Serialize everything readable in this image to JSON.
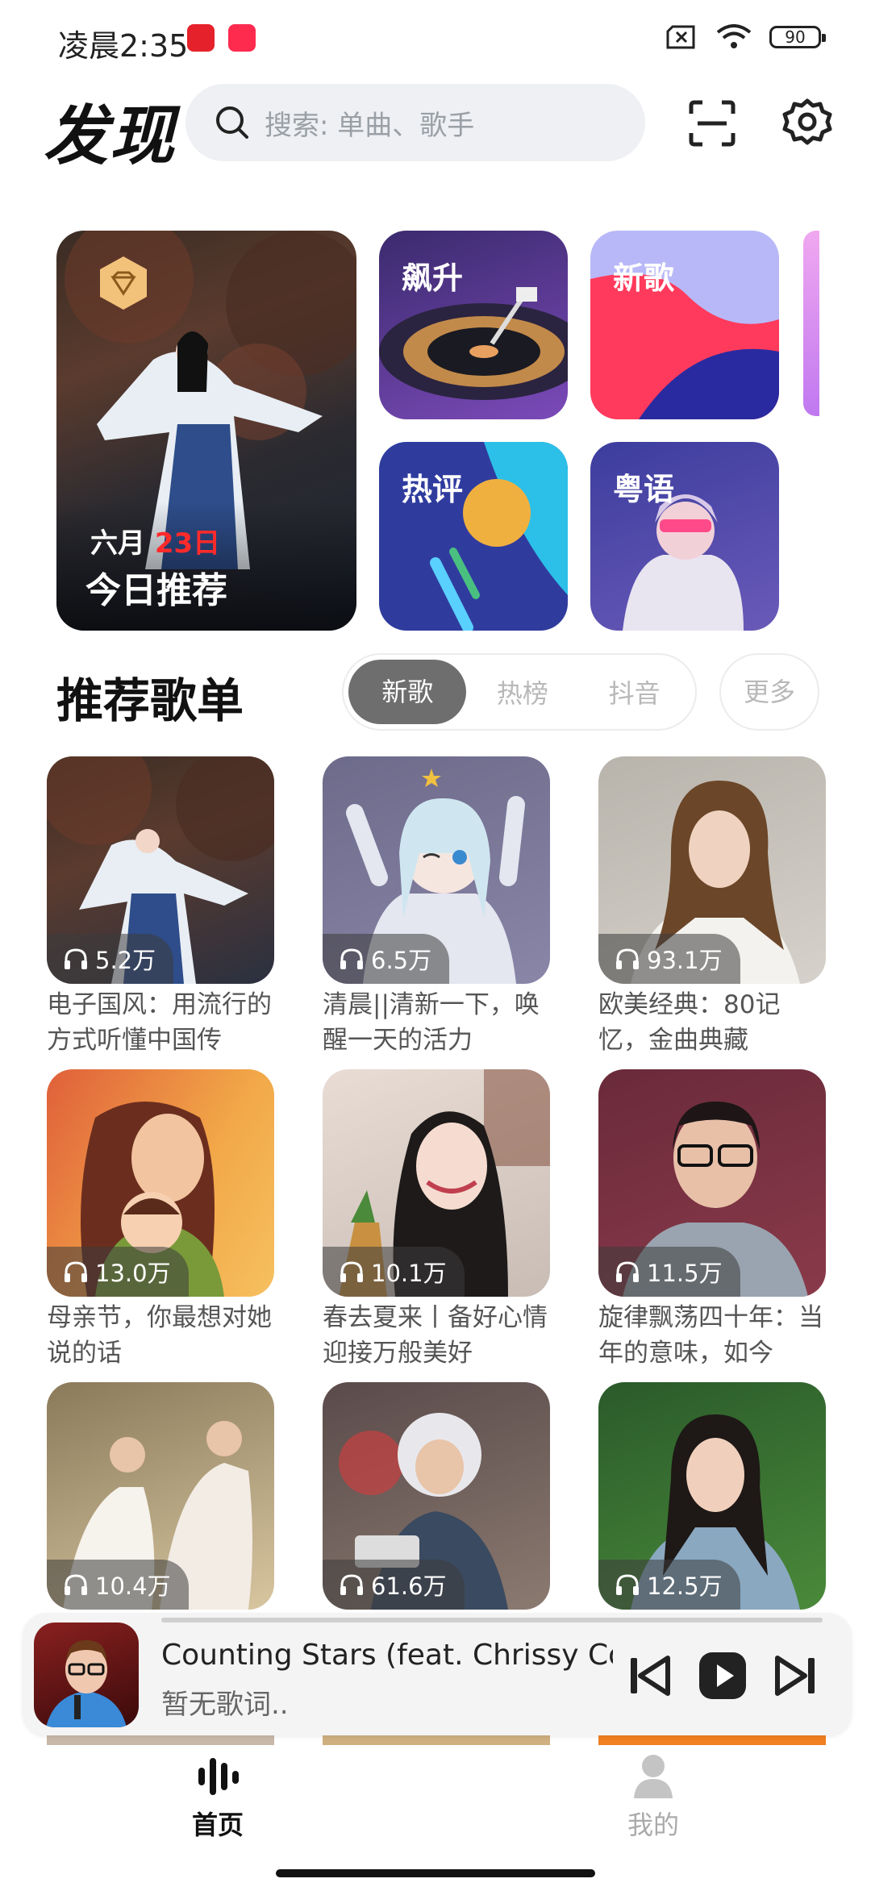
{
  "status_bar": {
    "time": "凌晨2:35",
    "battery": "90"
  },
  "header": {
    "title": "发现",
    "search_placeholder": "搜索: 单曲、歌手"
  },
  "featured": {
    "date_month": "六月",
    "date_day": "23日",
    "label": "今日推荐",
    "tiles": [
      "飙升",
      "新歌",
      "热评",
      "粤语"
    ]
  },
  "section": {
    "title": "推荐歌单",
    "tabs": [
      "新歌",
      "热榜",
      "抖音"
    ],
    "active_tab": "新歌",
    "more_label": "更多"
  },
  "playlists": [
    {
      "plays": "5.2万",
      "title": "电子国风：用流行的方式听懂中国传"
    },
    {
      "plays": "6.5万",
      "title": "清晨||清新一下，唤醒一天的活力"
    },
    {
      "plays": "93.1万",
      "title": "欧美经典：80记忆，金曲典藏"
    },
    {
      "plays": "13.0万",
      "title": "母亲节，你最想对她说的话"
    },
    {
      "plays": "10.1万",
      "title": "春去夏来丨备好心情迎接万般美好"
    },
    {
      "plays": "11.5万",
      "title": "旋律飘荡四十年：当年的意味，如今"
    },
    {
      "plays": "10.4万",
      "title": ""
    },
    {
      "plays": "61.6万",
      "title": ""
    },
    {
      "plays": "12.5万",
      "title": ""
    }
  ],
  "player": {
    "title": "Counting Stars (feat. Chrissy Co...",
    "lyric": "暂无歌词.."
  },
  "bottom_nav": [
    {
      "label": "首页",
      "active": true
    },
    {
      "label": "我的",
      "active": false
    }
  ],
  "colors": {
    "accent_red": "#e5222b",
    "active_tab": "#6e6e6e"
  }
}
